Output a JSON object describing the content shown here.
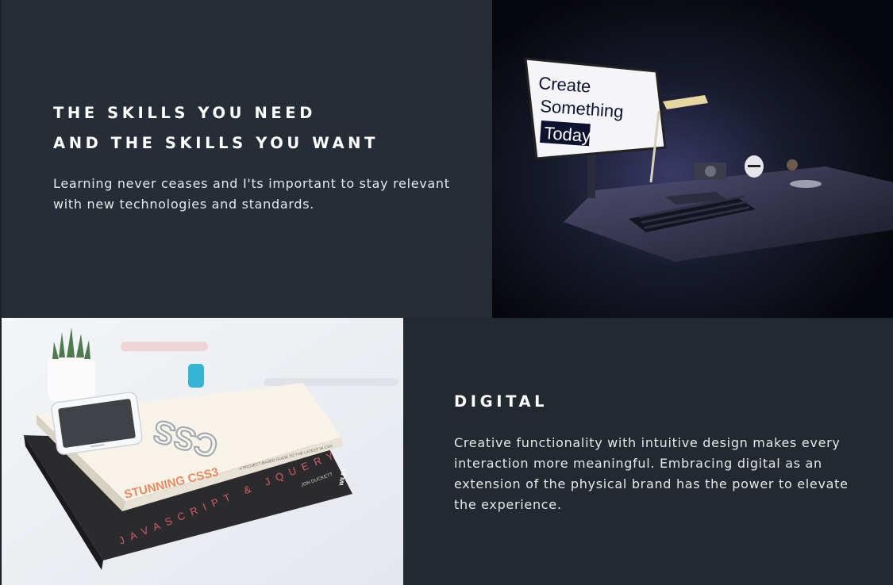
{
  "sections": [
    {
      "heading_lines": [
        "THE SKILLS YOU NEED",
        "AND THE SKILLS YOU WANT"
      ],
      "body_lines": [
        "Learning never ceases and I'ts important to stay relevant",
        "with new technologies and standards."
      ],
      "image": {
        "name": "desk-monitor-photo",
        "monitor_text": [
          "Create",
          "Something",
          "Today"
        ]
      }
    },
    {
      "heading_lines": [
        "DIGITAL"
      ],
      "body_lines": [
        "Creative functionality with intuitive design makes every",
        "interaction more meaningful. Embracing digital as an",
        "extension of the physical brand has the power to elevate",
        "the experience."
      ],
      "image": {
        "name": "books-phone-photo",
        "book_top_title": "STUNNING CSS3",
        "book_top_subtitle": "A PROJECT-BASED GUIDE TO THE LATEST IN CSS",
        "book_bottom_title": "JAVASCRIPT & JQUERY",
        "book_bottom_author": "JON DUCKETT",
        "book_bottom_publisher": "WILEY"
      }
    }
  ],
  "colors": {
    "panel_dark": "#272d36",
    "panel_darker": "#232931",
    "text_white": "#ffffff",
    "text_body": "#e6e8eb"
  }
}
